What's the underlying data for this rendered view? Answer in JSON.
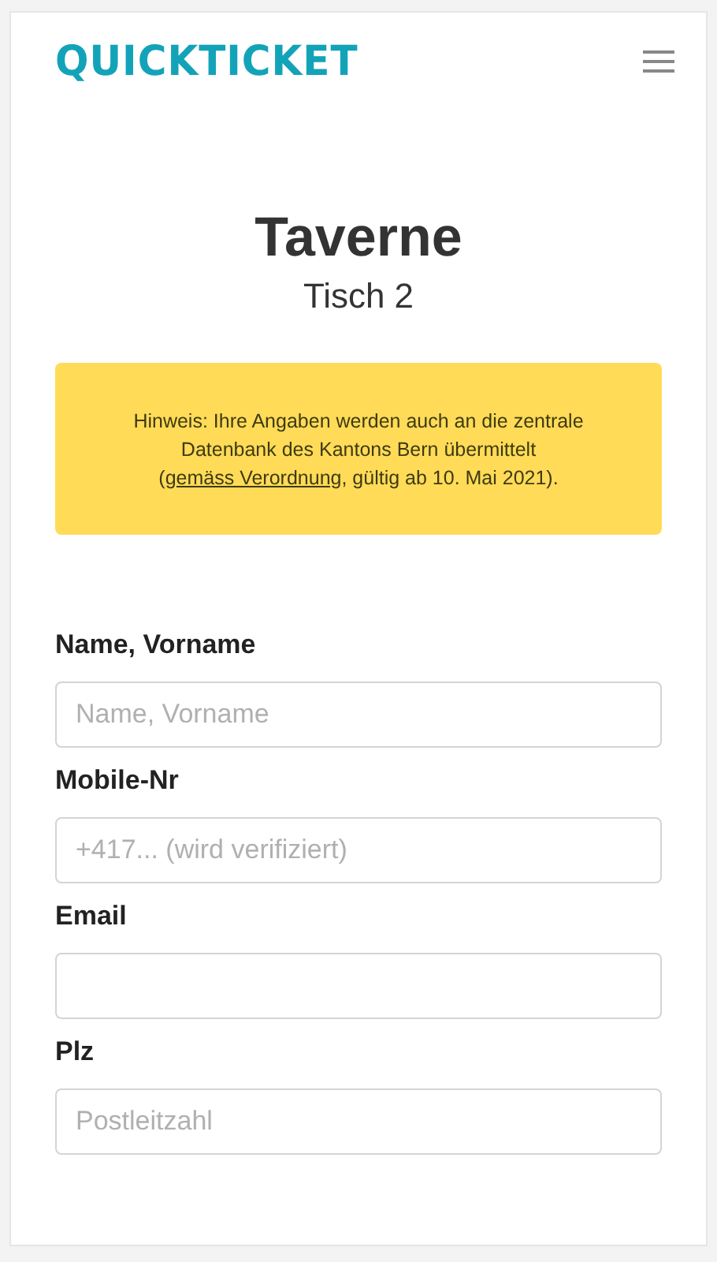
{
  "header": {
    "logo": "QUICKTICKET"
  },
  "venue": {
    "title": "Taverne",
    "table": "Tisch 2"
  },
  "notice": {
    "text_before": "Hinweis: Ihre Angaben werden auch an die zentrale Datenbank des Kantons Bern übermittelt (",
    "link": "gemäss Verordnung",
    "text_after": ", gültig ab 10. Mai 2021)."
  },
  "fields": [
    {
      "label": "Name, Vorname",
      "placeholder": "Name, Vorname"
    },
    {
      "label": "Mobile-Nr",
      "placeholder": "+417... (wird verifiziert)"
    },
    {
      "label": "Email"
    },
    {
      "label": "Plz",
      "placeholder": "Postleitzahl"
    }
  ]
}
